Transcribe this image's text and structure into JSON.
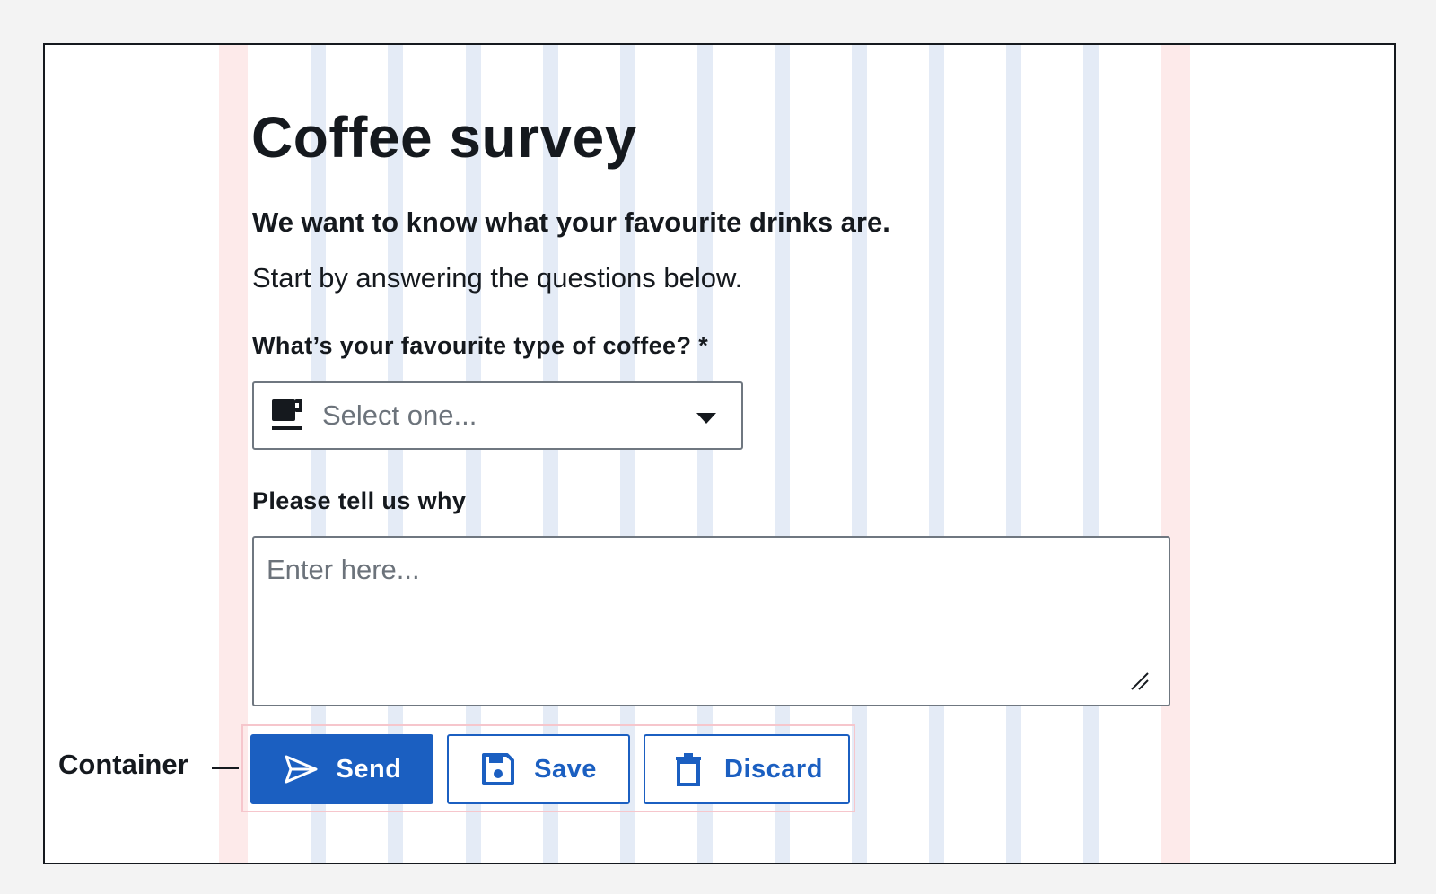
{
  "page": {
    "title": "Coffee survey",
    "lead": "We want to know what your favourite drinks are.",
    "intro": "Start by answering the questions below."
  },
  "form": {
    "coffee_question": {
      "label": "What’s your favourite type of coffee? *",
      "placeholder": "Select one...",
      "icon": "coffee-cup-icon"
    },
    "why_question": {
      "label": "Please tell us why",
      "placeholder": "Enter here..."
    }
  },
  "buttons": {
    "send": {
      "label": "Send",
      "icon": "send-icon"
    },
    "save": {
      "label": "Save",
      "icon": "save-icon"
    },
    "discard": {
      "label": "Discard",
      "icon": "trash-icon"
    }
  },
  "annotation": {
    "container_label": "Container"
  },
  "colors": {
    "primary": "#1b5fc1",
    "text": "#15191e",
    "placeholder": "#6c737b",
    "grid_column": "#e4ebf6",
    "grid_margin": "#fdeaea",
    "container_outline": "#f6c6cc"
  }
}
